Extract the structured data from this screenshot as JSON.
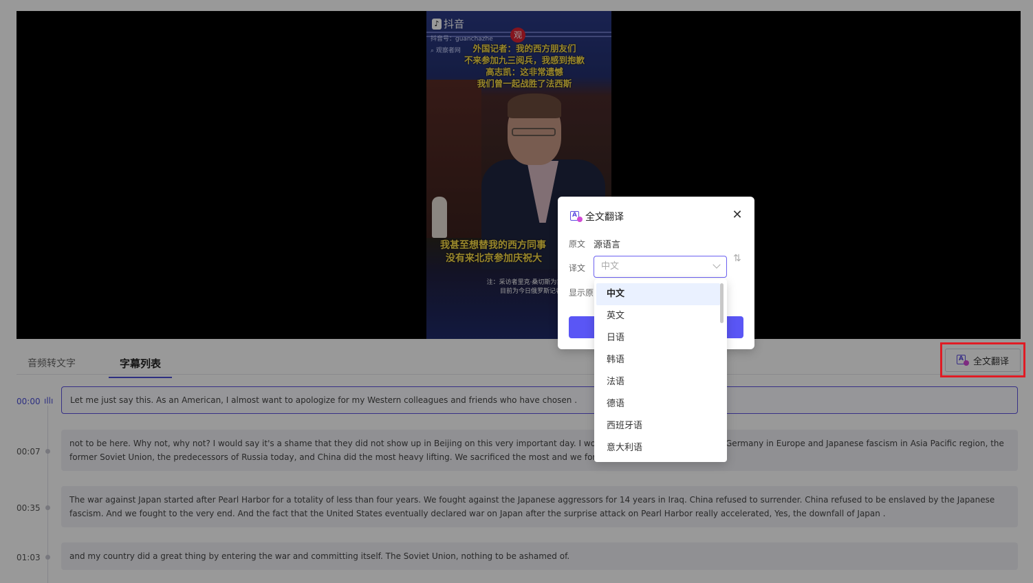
{
  "video": {
    "brand": "抖音",
    "account": "抖音号：guanchazhe",
    "search_text": "观察者网",
    "badge": "观",
    "top_subtitle": [
      "外国记者：我的西方朋友们",
      "不来参加九三阅兵，我感到抱歉",
      "高志凯：这非常遗憾",
      "我们曾一起战胜了法西斯"
    ],
    "bottom_subtitle": [
      "我甚至想替我的西方同事",
      "没有来北京参加庆祝大"
    ],
    "note": [
      "注：采访者里克·桑切斯为古巴裔",
      "目前为今日俄罗斯记者"
    ]
  },
  "tabs": [
    {
      "label": "音频转文字"
    },
    {
      "label": "字幕列表"
    }
  ],
  "toolbar": {
    "translate_label": "全文翻译"
  },
  "subtitles": [
    {
      "time": "00:00",
      "text": "Let me just say this. As an American, I almost want to apologize for my Western colleagues and friends who have chosen ."
    },
    {
      "time": "00:07",
      "text": "not to be here. Why not, why not? I would say it's a shame that they did not show up in Beijing on this very important day. I would say history wi … ating Nazi Germany in Europe and Japanese fascism in Asia Pacific region, the former Soviet Union, the predecessors of Russia today, and China did the most heavy lifting. We sacrificed the most and we for the longest fo"
    },
    {
      "time": "00:35",
      "text": "The war against Japan started after Pearl Harbor for a totality of less than four years. We fought against the Japanese aggressors for 14 years in Iraq. China refused to surrender. China refused to be enslaved by the Japanese fascism. And we fought to the very end. And the fact that the United States eventually declared war on Japan after the surprise attack on Pearl Harbor really accelerated, Yes, the downfall of Japan ."
    },
    {
      "time": "01:03",
      "text": "and my country did a great thing by entering the war and committing itself. The Soviet Union, nothing to be ashamed of."
    }
  ],
  "dialog": {
    "title": "全文翻译",
    "source_label": "原文",
    "source_value": "源语言",
    "target_label": "译文",
    "target_placeholder": "中文",
    "show_original_label": "显示原",
    "swap_symbol": "⇅",
    "close_symbol": "✕"
  },
  "dropdown": {
    "options": [
      "中文",
      "英文",
      "日语",
      "韩语",
      "法语",
      "德语",
      "西班牙语",
      "意大利语"
    ],
    "selected_index": 0
  },
  "colors": {
    "accent": "#5a56f5",
    "highlight": "#e01b24"
  }
}
